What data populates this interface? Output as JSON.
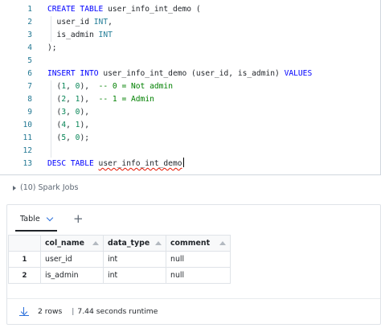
{
  "editor": {
    "lines": [
      {
        "n": "1",
        "tokens": [
          [
            "kw",
            "CREATE TABLE "
          ],
          [
            "id",
            "user_info_int_demo ("
          ]
        ]
      },
      {
        "n": "2",
        "tokens": [
          [
            "id",
            "  user_id "
          ],
          [
            "ty",
            "INT"
          ],
          [
            "id",
            ","
          ]
        ]
      },
      {
        "n": "3",
        "tokens": [
          [
            "id",
            "  is_admin "
          ],
          [
            "ty",
            "INT"
          ]
        ]
      },
      {
        "n": "4",
        "tokens": [
          [
            "id",
            ");"
          ]
        ]
      },
      {
        "n": "5",
        "tokens": []
      },
      {
        "n": "6",
        "tokens": [
          [
            "kw",
            "INSERT INTO "
          ],
          [
            "id",
            "user_info_int_demo (user_id, is_admin) "
          ],
          [
            "kw",
            "VALUES"
          ]
        ]
      },
      {
        "n": "7",
        "tokens": [
          [
            "id",
            "  ("
          ],
          [
            "num",
            "1"
          ],
          [
            "id",
            ", "
          ],
          [
            "num",
            "0"
          ],
          [
            "id",
            "),  "
          ],
          [
            "cm",
            "-- 0 = Not admin"
          ]
        ]
      },
      {
        "n": "8",
        "tokens": [
          [
            "id",
            "  ("
          ],
          [
            "num",
            "2"
          ],
          [
            "id",
            ", "
          ],
          [
            "num",
            "1"
          ],
          [
            "id",
            "),  "
          ],
          [
            "cm",
            "-- 1 = Admin"
          ]
        ]
      },
      {
        "n": "9",
        "tokens": [
          [
            "id",
            "  ("
          ],
          [
            "num",
            "3"
          ],
          [
            "id",
            ", "
          ],
          [
            "num",
            "0"
          ],
          [
            "id",
            "),"
          ]
        ]
      },
      {
        "n": "10",
        "tokens": [
          [
            "id",
            "  ("
          ],
          [
            "num",
            "4"
          ],
          [
            "id",
            ", "
          ],
          [
            "num",
            "1"
          ],
          [
            "id",
            "),"
          ]
        ]
      },
      {
        "n": "11",
        "tokens": [
          [
            "id",
            "  ("
          ],
          [
            "num",
            "5"
          ],
          [
            "id",
            ", "
          ],
          [
            "num",
            "0"
          ],
          [
            "id",
            ");"
          ]
        ]
      },
      {
        "n": "12",
        "tokens": []
      },
      {
        "n": "13",
        "tokens": [
          [
            "kw",
            "DESC TABLE "
          ],
          [
            "squiggle",
            "user_info_int_demo"
          ]
        ]
      }
    ]
  },
  "spark_jobs": {
    "label": "(10) Spark Jobs"
  },
  "result": {
    "tab_label": "Table",
    "add_tab_symbol": "+",
    "columns": [
      "col_name",
      "data_type",
      "comment"
    ],
    "rows": [
      {
        "num": "1",
        "cells": [
          "user_id",
          "int",
          "null"
        ]
      },
      {
        "num": "2",
        "cells": [
          "is_admin",
          "int",
          "null"
        ]
      }
    ],
    "footer": {
      "rows_text": "2 rows",
      "separator": "|",
      "runtime_text": "7.44 seconds runtime"
    }
  },
  "colors": {
    "keyword": "#0000ff",
    "type": "#267f99",
    "number": "#098658",
    "comment": "#008000",
    "line_number": "#237893",
    "accent": "#2a6fdb"
  }
}
